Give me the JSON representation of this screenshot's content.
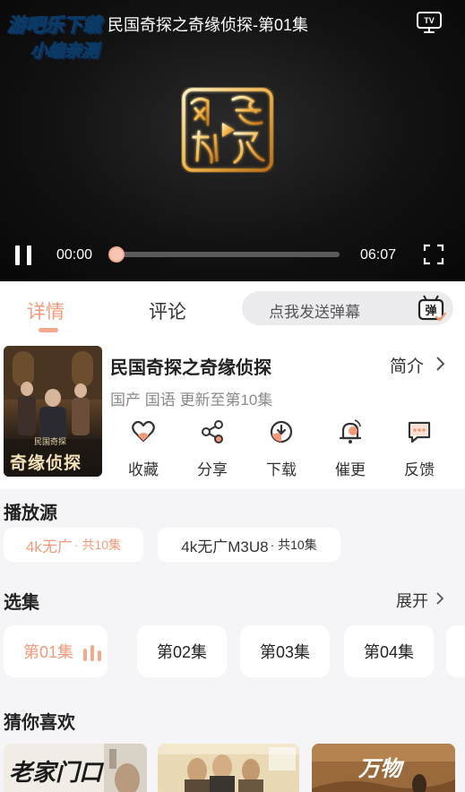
{
  "player": {
    "watermark_line1": "游吧乐下载",
    "watermark_line2": "小编亲测",
    "title": "民国奇探之奇缘侦探-第01集",
    "logo_text": "风行视频",
    "current_time": "00:00",
    "total_time": "06:07",
    "progress": 0.0,
    "icons": [
      "tv-cast-icon",
      "pause-icon",
      "fullscreen-icon"
    ],
    "accent": "#f4a58a"
  },
  "tabs": {
    "details": "详情",
    "comments": "评论",
    "danmaku_placeholder": "点我发送弹幕",
    "danmaku_icon_text": "弹"
  },
  "info": {
    "poster_title": "奇缘侦探",
    "poster_sub": "民国奇探",
    "title": "民国奇探之奇缘侦探",
    "intro": "简介",
    "meta": "国产 国语 更新至第10集",
    "actions": [
      {
        "label": "收藏",
        "icon": "heart-icon"
      },
      {
        "label": "分享",
        "icon": "share-icon"
      },
      {
        "label": "下载",
        "icon": "download-icon"
      },
      {
        "label": "催更",
        "icon": "bell-icon"
      },
      {
        "label": "反馈",
        "icon": "feedback-icon"
      }
    ]
  },
  "sources": {
    "title": "播放源",
    "items": [
      {
        "name": "4k无广",
        "count": " · 共10集"
      },
      {
        "name": "4k无广M3U8",
        "count": " · 共10集"
      }
    ]
  },
  "episodes": {
    "title": "选集",
    "expand": "展开",
    "items": [
      "第01集",
      "第02集",
      "第03集",
      "第04集"
    ]
  },
  "recommend": {
    "title": "猜你喜欢",
    "items": [
      {
        "poster_text": "老家门口"
      },
      {
        "poster_text": ""
      },
      {
        "poster_text": "万物"
      }
    ]
  },
  "colors": {
    "accent": "#f39a7a",
    "background": "#f5f5f7",
    "card": "#ffffff"
  }
}
